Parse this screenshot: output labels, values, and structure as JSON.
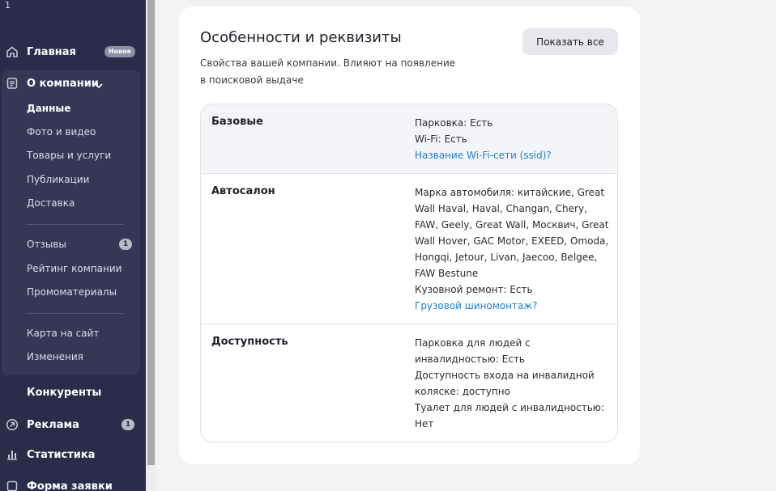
{
  "sidebar": {
    "top_mark": "1",
    "items": [
      {
        "label": "Главная",
        "icon": "home-icon",
        "badge": "Новое"
      },
      {
        "label": "О компании",
        "icon": "document-icon"
      },
      {
        "label": "Конкуренты"
      },
      {
        "label": "Реклама",
        "icon": "arrow-circle-icon",
        "badge": "1"
      },
      {
        "label": "Статистика",
        "icon": "bar-chart-icon"
      },
      {
        "label": "Форма заявки",
        "icon": "form-icon"
      }
    ],
    "company_sub": [
      {
        "label": "Данные"
      },
      {
        "label": "Фото и видео"
      },
      {
        "label": "Товары и услуги"
      },
      {
        "label": "Публикации"
      },
      {
        "label": "Доставка"
      },
      {
        "label": "Отзывы",
        "badge": "1"
      },
      {
        "label": "Рейтинг компании"
      },
      {
        "label": "Промоматериалы"
      },
      {
        "label": "Карта на сайт"
      },
      {
        "label": "Изменения"
      }
    ]
  },
  "card": {
    "title": "Особенности и реквизиты",
    "subtitle": "Свойства вашей компании. Влияют на появление в поисковой выдаче",
    "show_all": "Показать все",
    "rows": [
      {
        "title": "Базовые",
        "lines": [
          "Парковка: Есть",
          "Wi-Fi: Есть"
        ],
        "link": "Название Wi-Fi-сети (ssid)?"
      },
      {
        "title": "Автосалон",
        "lines": [
          "Марка автомобиля: китайские, Great Wall Haval, Haval, Changan, Chery, FAW, Geely, Great Wall, Москвич, Great Wall Hover, GAC Motor, EXEED, Omoda, Hongqi, Jetour, Livan, Jaecoo, Belgee, FAW Bestune",
          "Кузовной ремонт: Есть"
        ],
        "link": "Грузовой шиномонтаж?"
      },
      {
        "title": "Доступность",
        "lines": [
          "Парковка для людей с инвалидностью: Есть",
          "Доступность входа на инвалидной коляске: доступно",
          "Туалет для людей с инвалидностью: Нет"
        ]
      }
    ]
  },
  "colors": {
    "sidebar_bg": "#2a2c4a",
    "sidebar_group_bg": "#353755",
    "link": "#1f7fd1",
    "page_bg": "#f2f3f5"
  }
}
